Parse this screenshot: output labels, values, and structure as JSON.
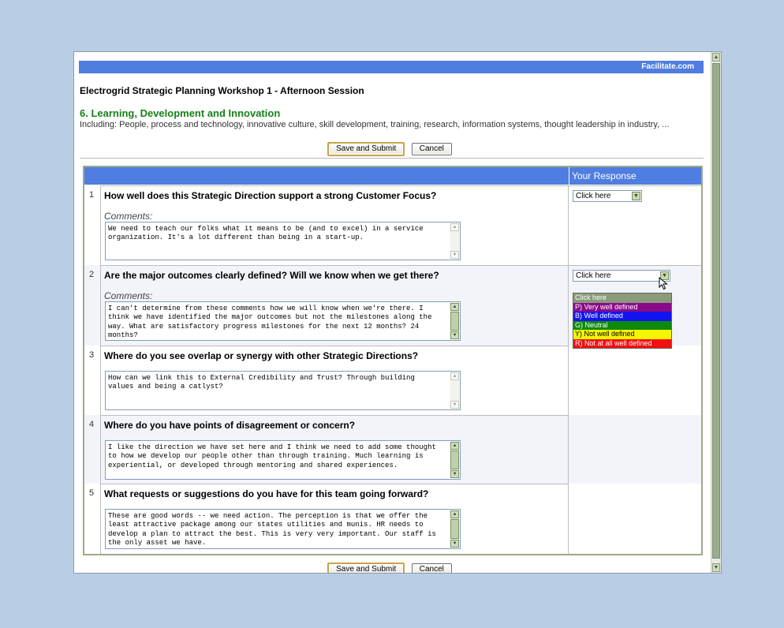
{
  "header": {
    "brand": "Facilitate.com"
  },
  "session_title": "Electrogrid Strategic Planning Workshop 1 - Afternoon Session",
  "section": {
    "title": "6. Learning, Development and Innovation",
    "description": "Including: People, process and technology, innovative culture, skill development, training, research, information systems, thought leadership in industry, ..."
  },
  "buttons": {
    "save": "Save and Submit",
    "cancel": "Cancel"
  },
  "grid": {
    "response_header": "Your Response"
  },
  "questions": [
    {
      "number": "1",
      "text": "How well does this Strategic Direction support a strong Customer Focus?",
      "comment_label": "Comments:",
      "comment": "We need to teach our folks what it means to be (and to excel) in a service organization.  It's a lot different than being in a start-up.",
      "response": "Click here"
    },
    {
      "number": "2",
      "text": "Are the major outcomes clearly defined? Will we know when we get there?",
      "comment_label": "Comments:",
      "comment": "I can't determine from these comments how we will know when we're there. I think we have identified the major outcomes but not the milestones along the way. What are satisfactory progress milestones for the next 12 months? 24 months?",
      "response": "Click here"
    },
    {
      "number": "3",
      "text": "Where do you see overlap or synergy with other Strategic Directions?",
      "comment": "How can we link this to External Credibility and Trust? Through building values and being a catlyst?"
    },
    {
      "number": "4",
      "text": "Where do you have points of disagreement or concern?",
      "comment": "I like the direction we have set here and I think we need to add some thought to how we develop our people other than through training.  Much learning is experiential, or developed through mentoring and shared experiences."
    },
    {
      "number": "5",
      "text": "What requests or suggestions do you have for this team going forward?",
      "comment": "These are good words -- we need action. The perception is that we offer the least attractive package among our states utilities and munis. HR needs to develop a plan to attract the best. This is very very important.  Our staff is the only asset we have."
    }
  ],
  "dropdown_options": [
    {
      "label": "Click here",
      "bg": "#8b9a7a",
      "fg": "#ffffff"
    },
    {
      "label": "P) Very well defined",
      "bg": "#8a0a8a",
      "fg": "#ffffff"
    },
    {
      "label": "B) Well defined",
      "bg": "#1414f0",
      "fg": "#ffffff"
    },
    {
      "label": "G) Neutral",
      "bg": "#0c8a0c",
      "fg": "#ffffff"
    },
    {
      "label": "Y) Not well defined",
      "bg": "#f5f500",
      "fg": "#000000"
    },
    {
      "label": "R) Not at all well defined",
      "bg": "#f01010",
      "fg": "#ffffff"
    }
  ]
}
